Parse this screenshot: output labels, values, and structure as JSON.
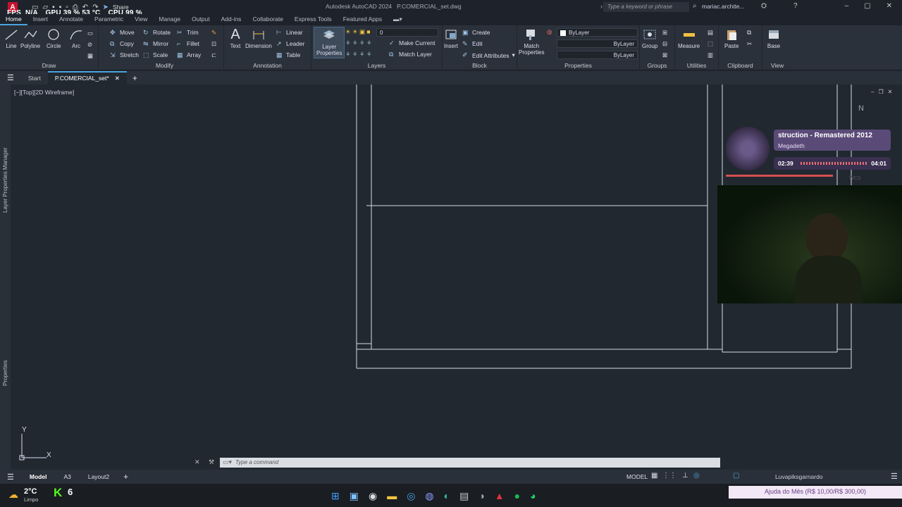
{
  "app": {
    "logo": "A",
    "title": "Autodesk AutoCAD 2024",
    "filename": "P.COMERCIAL_set.dwg",
    "share_label": "Share",
    "search_placeholder": "Type a keyword or phrase",
    "user": "mariac.archite..."
  },
  "overlay": {
    "fps": "FPS",
    "na": "N/A",
    "gpu": "GPU",
    "gpu_val": "39 %",
    "gpu_temp": "53 °C",
    "cpu": "CPU",
    "cpu_val": "99 %"
  },
  "menu": [
    "Home",
    "Insert",
    "Annotate",
    "Parametric",
    "View",
    "Manage",
    "Output",
    "Add-ins",
    "Collaborate",
    "Express Tools",
    "Featured Apps"
  ],
  "ribbon": {
    "draw": {
      "title": "Draw",
      "line": "Line",
      "polyline": "Polyline",
      "circle": "Circle",
      "arc": "Arc"
    },
    "modify": {
      "title": "Modify",
      "move": "Move",
      "rotate": "Rotate",
      "trim": "Trim",
      "copy": "Copy",
      "mirror": "Mirror",
      "fillet": "Fillet",
      "stretch": "Stretch",
      "scale": "Scale",
      "array": "Array"
    },
    "annotation": {
      "title": "Annotation",
      "text": "Text",
      "dimension": "Dimension",
      "linear": "Linear",
      "leader": "Leader",
      "table": "Table"
    },
    "layers": {
      "title": "Layers",
      "layer_properties_1": "Layer",
      "layer_properties_2": "Properties",
      "current_layer": "0",
      "make_current": "Make Current",
      "match_layer": "Match Layer"
    },
    "block": {
      "title": "Block",
      "insert": "Insert",
      "create": "Create",
      "edit": "Edit",
      "edit_attributes": "Edit Attributes"
    },
    "properties": {
      "title": "Properties",
      "match_1": "Match",
      "match_2": "Properties",
      "color": "ByLayer",
      "linetype": "ByLayer",
      "lineweight": "ByLayer"
    },
    "groups": {
      "title": "Groups",
      "group": "Group"
    },
    "utilities": {
      "title": "Utilities",
      "measure": "Measure"
    },
    "clipboard": {
      "title": "Clipboard",
      "paste": "Paste"
    },
    "view": {
      "title": "View",
      "base": "Base"
    }
  },
  "tabs": {
    "start": "Start",
    "active": "P.COMERCIAL_set*"
  },
  "viewport": {
    "label": "[−][Top][2D Wireframe]",
    "side_layer": "Layer Properties Manager",
    "side_props": "Properties",
    "compass": "N",
    "wcs": "WCS",
    "ucs_y": "Y",
    "ucs_x": "X"
  },
  "command": {
    "placeholder": "Type a command"
  },
  "layout_tabs": [
    "Model",
    "A3",
    "Layout2"
  ],
  "status": {
    "model": "MODEL",
    "ticker": "Luvapiksgarnardo"
  },
  "media": {
    "track": "struction - Remastered 2012",
    "artist": "Megadeth",
    "elapsed": "02:39",
    "total": "04:01"
  },
  "taskbar": {
    "weather_temp": "2°C",
    "weather_desc": "Limpo",
    "k_value": "6",
    "donation": "Ajuda do Mês (R$ 10,00/R$ 300,00)"
  }
}
